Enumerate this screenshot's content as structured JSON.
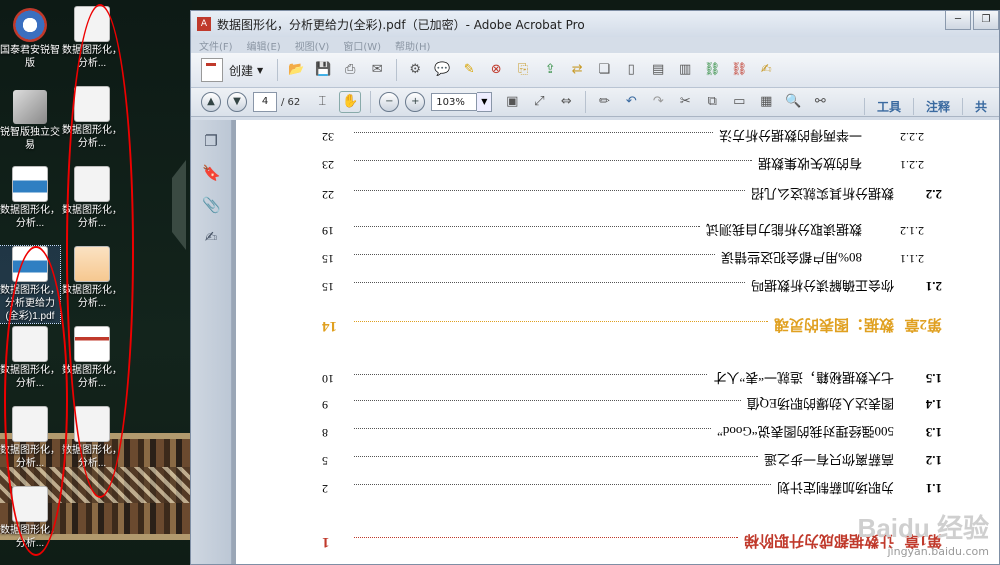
{
  "desktop": {
    "icons": [
      {
        "label": "国泰君安锐智版",
        "kind": "app-guotai"
      },
      {
        "label": "锐智版独立交易",
        "kind": "app-handshake"
      },
      {
        "label": "数据图形化，分析...",
        "kind": "pdf-blue"
      },
      {
        "label": "数据图形化，分析更给力(全彩)1.pdf",
        "kind": "pdf-blue-selected"
      },
      {
        "label": "数据图形化，分析...",
        "kind": "pdf-doc"
      },
      {
        "label": "数据图形化，分析...",
        "kind": "pdf-doc"
      },
      {
        "label": "数据图形化，分析...",
        "kind": "pdf-doc"
      },
      {
        "label": "数据图形化，分析...",
        "kind": "pdf-doc"
      },
      {
        "label": "数据图形化，分析...",
        "kind": "pdf-doc"
      },
      {
        "label": "数据图形化，分析...",
        "kind": "pdf-orange"
      },
      {
        "label": "数据图形化，分析...",
        "kind": "pdf-red"
      },
      {
        "label": "数据图形化，分析...",
        "kind": "pdf-doc"
      },
      {
        "label": "数据图形化，分析...",
        "kind": "pdf-doc"
      }
    ],
    "annotation_color": "#e00000"
  },
  "window": {
    "title": "数据图形化，分析更给力(全彩).pdf（已加密）- Adobe Acrobat Pro",
    "controls": [
      "minimize-icon",
      "restore-icon"
    ],
    "menu": [
      "文件(F)",
      "编辑(E)",
      "视图(V)",
      "窗口(W)",
      "帮助(H)"
    ],
    "create_label": "创建",
    "page_current": "4",
    "page_total": "/ 62",
    "zoom": "103%",
    "right_links": [
      "工具",
      "注释",
      "共"
    ]
  },
  "toc": {
    "rows": [
      {
        "num": "第1章",
        "title": "让数据都成为升职阶梯",
        "page": "1",
        "style": "ch1"
      },
      {
        "num": "1.1",
        "title": "为职场加薪制定计划",
        "page": "2",
        "style": "sec"
      },
      {
        "num": "1.2",
        "title": "高薪离你只有一步之遥",
        "page": "5",
        "style": "sec"
      },
      {
        "num": "1.3",
        "title": "500强经理对我的图表说“Good”",
        "page": "8",
        "style": "sec"
      },
      {
        "num": "1.4",
        "title": "图表达人劲爆的职场EQ值",
        "page": "9",
        "style": "sec"
      },
      {
        "num": "1.5",
        "title": "七大数据秘籍，造就一“表”人才",
        "page": "10",
        "style": "sec"
      },
      {
        "num": "第2章",
        "title": "数据：图表的灵魂",
        "page": "14",
        "style": "ch2"
      },
      {
        "num": "2.1",
        "title": "你会正确解读分析数据吗",
        "page": "15",
        "style": "sec"
      },
      {
        "num": "2.1.1",
        "title": "80%用户都会犯这些错误",
        "page": "15",
        "style": "sub"
      },
      {
        "num": "2.1.2",
        "title": "数据读取分析能力自我测试",
        "page": "19",
        "style": "sub"
      },
      {
        "num": "2.2",
        "title": "数据分析其实就这么几招",
        "page": "22",
        "style": "sec"
      },
      {
        "num": "2.2.1",
        "title": "有的放矢收集数据",
        "page": "23",
        "style": "sub"
      },
      {
        "num": "2.2.2",
        "title": "一举两得的数据分析方法",
        "page": "32",
        "style": "sub"
      }
    ]
  },
  "watermark": {
    "brand": "Baidu 经验",
    "url": "jingyan.baidu.com"
  }
}
